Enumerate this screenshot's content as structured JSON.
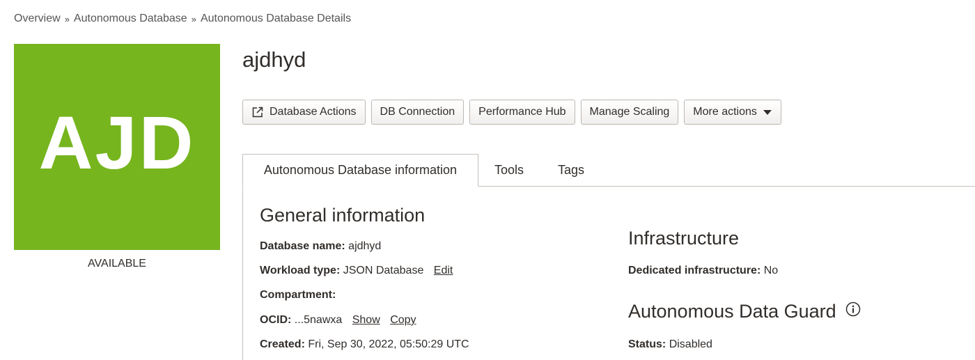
{
  "breadcrumb": {
    "items": [
      "Overview",
      "Autonomous Database",
      "Autonomous Database Details"
    ],
    "separator": "»"
  },
  "resource": {
    "logo_text": "AJD",
    "logo_color": "#76b51e",
    "status": "AVAILABLE",
    "title": "ajdhyd"
  },
  "actions": {
    "database_actions": "Database Actions",
    "db_connection": "DB Connection",
    "performance_hub": "Performance Hub",
    "manage_scaling": "Manage Scaling",
    "more_actions": "More actions"
  },
  "tabs": [
    {
      "label": "Autonomous Database information",
      "active": true
    },
    {
      "label": "Tools",
      "active": false
    },
    {
      "label": "Tags",
      "active": false
    }
  ],
  "general": {
    "title": "General information",
    "database_name_label": "Database name:",
    "database_name": "ajdhyd",
    "workload_label": "Workload type:",
    "workload": "JSON Database",
    "edit_link": "Edit",
    "compartment_label": "Compartment:",
    "ocid_label": "OCID:",
    "ocid": "...5nawxa",
    "show_link": "Show",
    "copy_link": "Copy",
    "created_label": "Created:",
    "created": "Fri, Sep 30, 2022, 05:50:29 UTC"
  },
  "infrastructure": {
    "title": "Infrastructure",
    "dedicated_label": "Dedicated infrastructure:",
    "dedicated": "No"
  },
  "data_guard": {
    "title": "Autonomous Data Guard",
    "status_label": "Status:",
    "status": "Disabled"
  }
}
